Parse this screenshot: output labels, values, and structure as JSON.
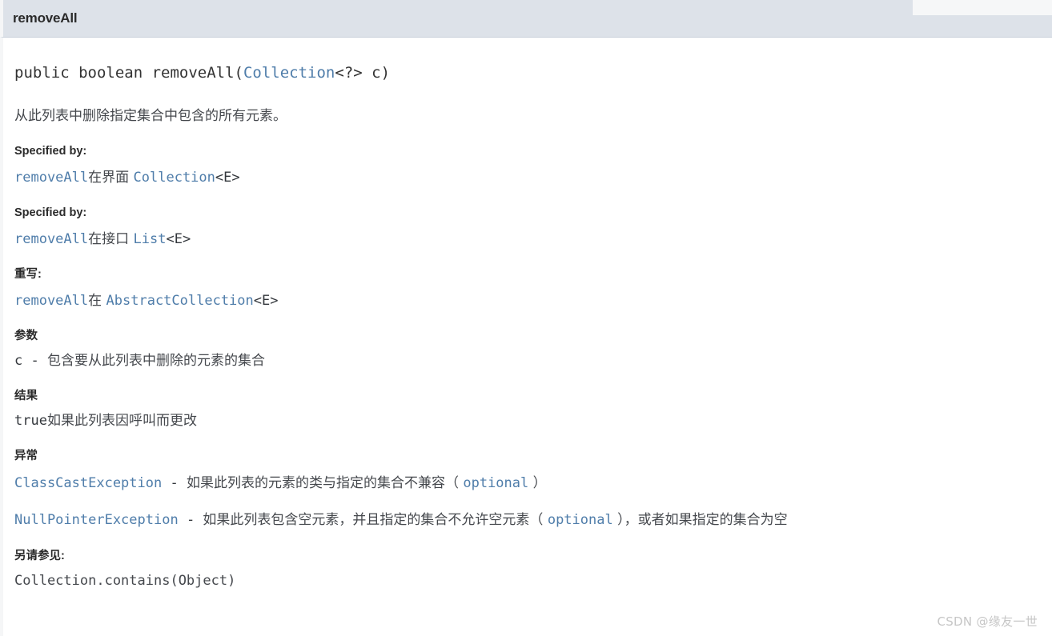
{
  "header": {
    "title": "removeAll"
  },
  "signature": {
    "prefix": "public boolean removeAll(",
    "param_type": "Collection",
    "generic": "<?> ",
    "param_name": "c)"
  },
  "description": "从此列表中删除指定集合中包含的所有元素。",
  "blocks": [
    {
      "label": "Specified by:",
      "member": "removeAll",
      "connector": "在界面 ",
      "owner": "Collection",
      "generic": "<E>"
    },
    {
      "label": "Specified by:",
      "member": "removeAll",
      "connector": "在接口 ",
      "owner": "List",
      "generic": "<E>"
    },
    {
      "label": "重写:",
      "member": "removeAll",
      "connector": "在 ",
      "owner": "AbstractCollection",
      "generic": "<E>"
    }
  ],
  "params": {
    "label": "参数",
    "name": "c",
    "separator": " - ",
    "text": "包含要从此列表中删除的元素的集合"
  },
  "returns": {
    "label": "结果",
    "value": "true",
    "text": "如果此列表因呼叫而更改"
  },
  "throws": {
    "label": "异常",
    "items": [
      {
        "type": "ClassCastException",
        "separator": " - ",
        "text_before": "如果此列表的元素的类与指定的集合不兼容（ ",
        "optional": "optional",
        "text_after": " ）"
      },
      {
        "type": "NullPointerException",
        "separator": " - ",
        "text_before": "如果此列表包含空元素，并且指定的集合不允许空元素（ ",
        "optional": "optional",
        "text_after": " ），或者如果指定的集合为空"
      }
    ]
  },
  "see_also": {
    "label": "另请参见:",
    "link": "Collection.contains(Object)"
  },
  "watermark": "CSDN @缘友一世",
  "colors": {
    "header_bg": "#dde2e9",
    "link": "#4f7daa",
    "text": "#45484d",
    "watermark": "#c6c6c6"
  }
}
